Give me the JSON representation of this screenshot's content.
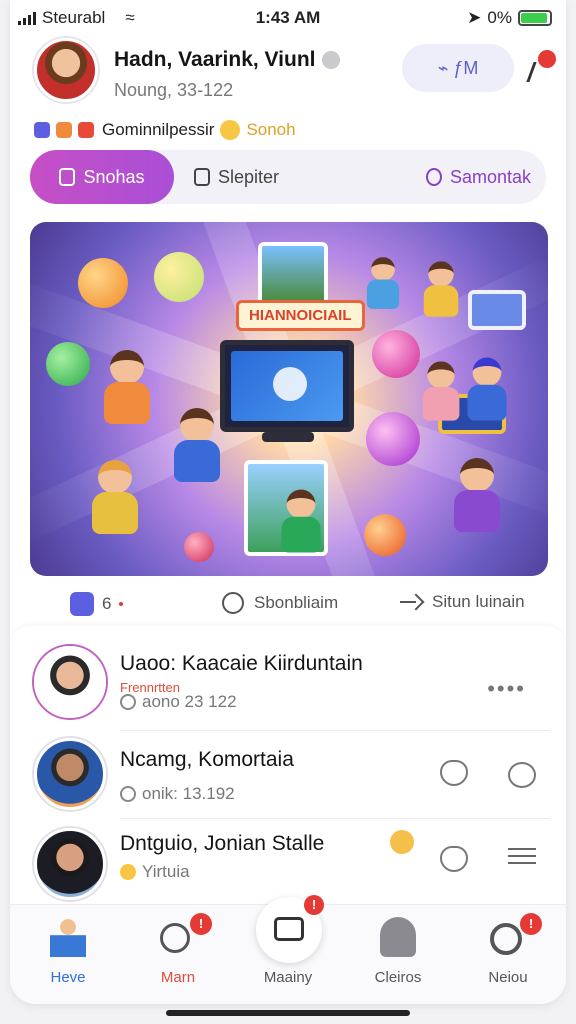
{
  "status_bar": {
    "carrier": "Steurabl",
    "time": "1:43 AM",
    "battery": "0%",
    "battery_level": 0.92
  },
  "header": {
    "name": "Hadn, Vaarink, Viunl",
    "subtitle": "Noung, 33-122",
    "pill_button": "⌁ ƒM"
  },
  "subline": {
    "text": "Gominnilpessir",
    "highlight": "Sonoh"
  },
  "tabs": [
    {
      "label": "Snohas",
      "active": true
    },
    {
      "label": "Slepiter",
      "active": false
    },
    {
      "label": "Samontak",
      "active": false
    }
  ],
  "hero": {
    "banner": "HIANNOICIAIL"
  },
  "actions": {
    "count": "6",
    "comment_label": "Sbonbliaim",
    "share_label": "Situn luinain"
  },
  "list": [
    {
      "name": "Uaoo: Kaacaie Kiirduntain",
      "tagline": "Frennrtten",
      "meta": "aono 23 122"
    },
    {
      "name": "Ncamg, Komortaia",
      "tagline": "",
      "meta": "onik: 13.192"
    },
    {
      "name": "Dntguio, Jonian Stalle",
      "tagline": "",
      "meta": "Yirtuia"
    }
  ],
  "tabbar": [
    {
      "label": "Heve",
      "active": true,
      "badge": ""
    },
    {
      "label": "Marn",
      "active": false,
      "badge": "!"
    },
    {
      "label": "Maainy",
      "active": false,
      "badge": "!"
    },
    {
      "label": "Cleiros",
      "active": false,
      "badge": ""
    },
    {
      "label": "Neiou",
      "active": false,
      "badge": "!"
    }
  ],
  "colors": {
    "accent": "#b04fd0",
    "primary": "#2f6fe0",
    "badge": "#e53935",
    "battery": "#3ccf4e"
  }
}
